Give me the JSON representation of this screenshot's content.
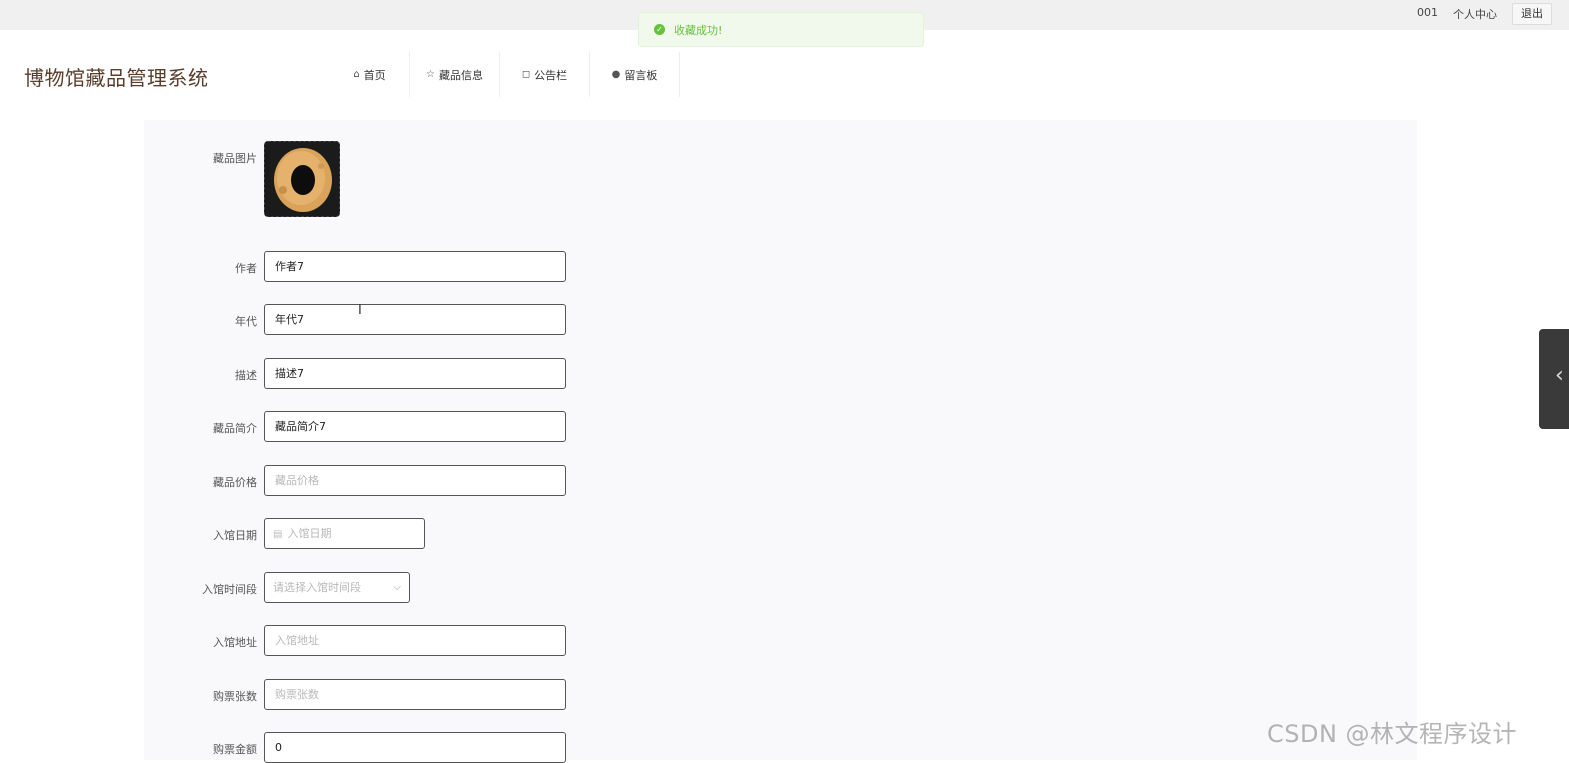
{
  "topbar": {
    "user": "001",
    "center": "个人中心",
    "logout": "退出"
  },
  "toast": {
    "message": "收藏成功!"
  },
  "site": {
    "title": "博物馆藏品管理系统"
  },
  "nav": [
    {
      "icon": "home-icon",
      "label": "首页"
    },
    {
      "icon": "star-icon",
      "label": "藏品信息"
    },
    {
      "icon": "bag-icon",
      "label": "公告栏"
    },
    {
      "icon": "info-icon",
      "label": "留言板"
    }
  ],
  "form": {
    "image_label": "藏品图片",
    "author": {
      "label": "作者",
      "value": "作者7"
    },
    "era": {
      "label": "年代",
      "value": "年代7"
    },
    "desc": {
      "label": "描述",
      "value": "描述7"
    },
    "intro": {
      "label": "藏品简介",
      "value": "藏品简介7"
    },
    "price": {
      "label": "藏品价格",
      "placeholder": "藏品价格"
    },
    "entry_date": {
      "label": "入馆日期",
      "placeholder": "入馆日期"
    },
    "entry_time": {
      "label": "入馆时间段",
      "placeholder": "请选择入馆时间段"
    },
    "entry_addr": {
      "label": "入馆地址",
      "placeholder": "入馆地址"
    },
    "tickets": {
      "label": "购票张数",
      "placeholder": "购票张数"
    },
    "amount": {
      "label": "购票金额",
      "value": "0"
    }
  },
  "watermark": "CSDN @林文程序设计"
}
